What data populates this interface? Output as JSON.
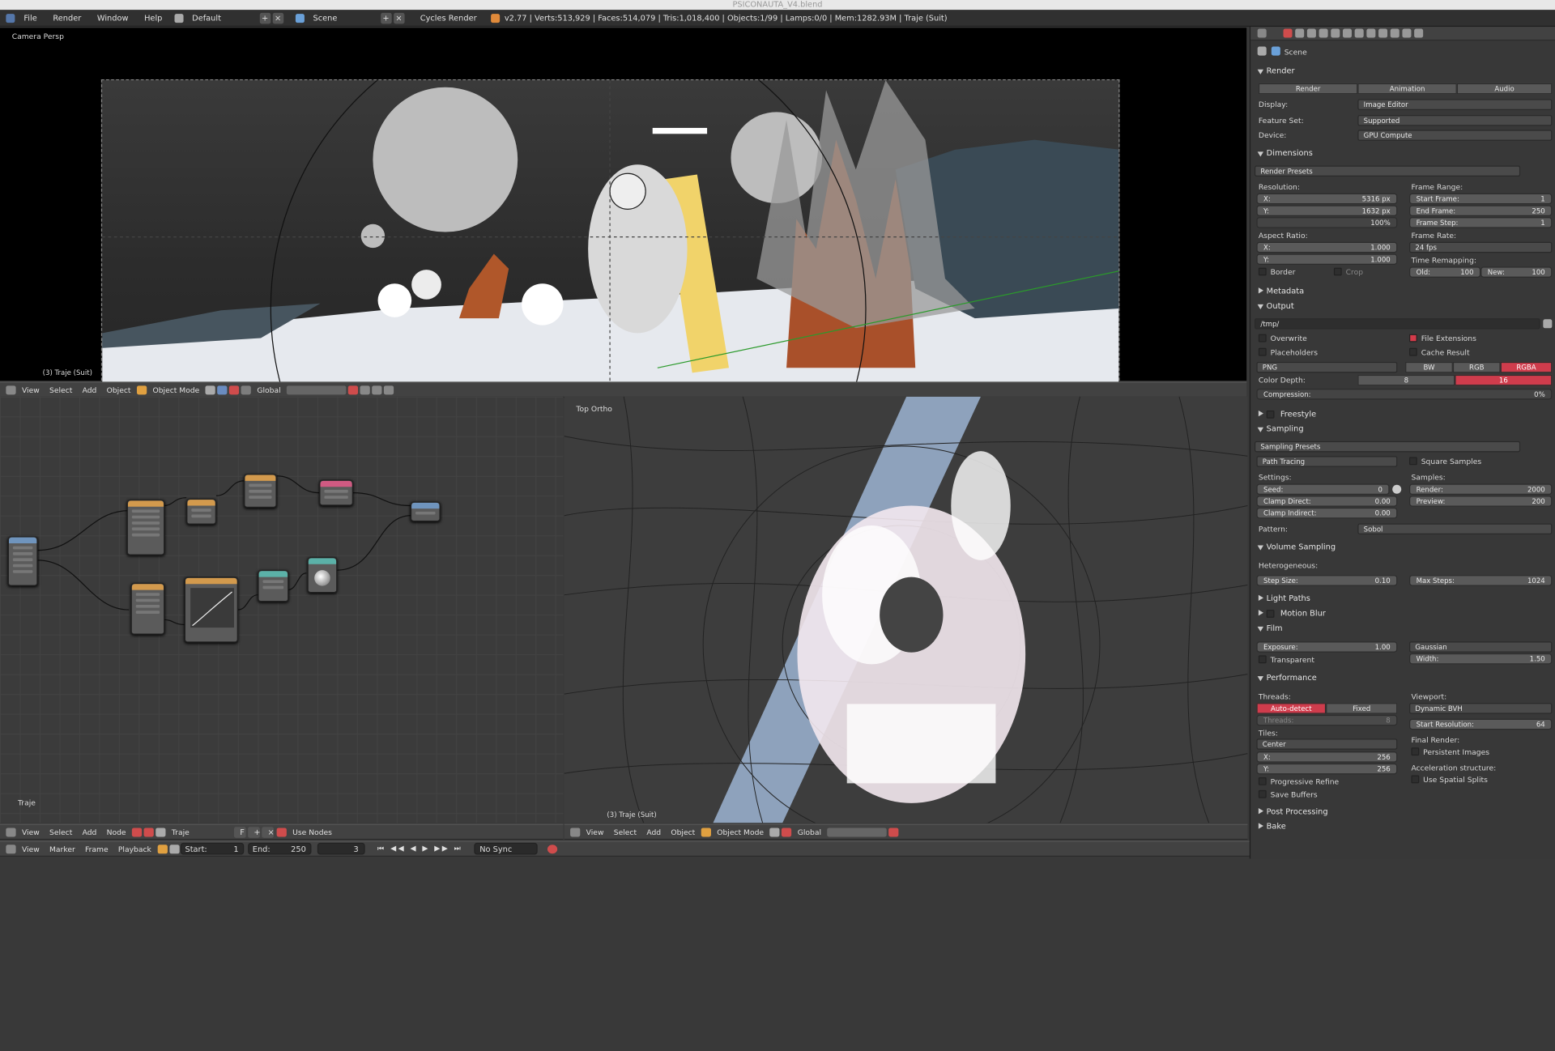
{
  "window": {
    "title": "PSICONAUTA_V4.blend"
  },
  "topbar": {
    "menus": [
      "File",
      "Render",
      "Window",
      "Help"
    ],
    "layout": "Default",
    "scene": "Scene",
    "engine": "Cycles Render",
    "stats": "v2.77 | Verts:513,929 | Faces:514,079 | Tris:1,018,400 | Objects:1/99 | Lamps:0/0 | Mem:1282.93M | Traje (Suit)"
  },
  "viewport_top": {
    "label": "Camera Persp",
    "object": "(3) Traje (Suit)"
  },
  "header_3d": {
    "menus": [
      "View",
      "Select",
      "Add",
      "Object"
    ],
    "mode": "Object Mode",
    "orientation": "Global"
  },
  "node_editor": {
    "label": "Traje",
    "menus": [
      "View",
      "Select",
      "Add",
      "Node"
    ],
    "material": "Traje",
    "use_nodes": "Use Nodes"
  },
  "viewport_bottom": {
    "label": "Top Ortho",
    "object": "(3) Traje (Suit)",
    "menus": [
      "View",
      "Select",
      "Add",
      "Object"
    ],
    "mode": "Object Mode",
    "orientation": "Global"
  },
  "timeline": {
    "menus": [
      "View",
      "Marker",
      "Frame",
      "Playback"
    ],
    "start_label": "Start:",
    "start": "1",
    "end_label": "End:",
    "end": "250",
    "current": "3",
    "sync": "No Sync"
  },
  "properties": {
    "breadcrumb": "Scene",
    "render": {
      "title": "Render",
      "buttons": [
        "Render",
        "Animation",
        "Audio"
      ],
      "display_label": "Display:",
      "display": "Image Editor",
      "feature_label": "Feature Set:",
      "feature": "Supported",
      "device_label": "Device:",
      "device": "GPU Compute"
    },
    "dimensions": {
      "title": "Dimensions",
      "presets": "Render Presets",
      "resolution_label": "Resolution:",
      "res_x_label": "X:",
      "res_x": "5316 px",
      "res_y_label": "Y:",
      "res_y": "1632 px",
      "res_pct": "100%",
      "aspect_label": "Aspect Ratio:",
      "asp_x_label": "X:",
      "asp_x": "1.000",
      "asp_y_label": "Y:",
      "asp_y": "1.000",
      "border": "Border",
      "crop": "Crop",
      "frame_range_label": "Frame Range:",
      "start_label": "Start Frame:",
      "start": "1",
      "end_label": "End Frame:",
      "end": "250",
      "step_label": "Frame Step:",
      "step": "1",
      "rate_label": "Frame Rate:",
      "rate": "24 fps",
      "remap_label": "Time Remapping:",
      "old_label": "Old:",
      "old": "100",
      "new_label": "New:",
      "new": "100"
    },
    "metadata": "Metadata",
    "output": {
      "title": "Output",
      "path": "/tmp/",
      "overwrite": "Overwrite",
      "file_ext": "File Extensions",
      "placeholders": "Placeholders",
      "cache": "Cache Result",
      "format": "PNG",
      "modes": [
        "BW",
        "RGB",
        "RGBA"
      ],
      "depth_label": "Color Depth:",
      "depths": [
        "8",
        "16"
      ],
      "compression_label": "Compression:",
      "compression": "0%"
    },
    "freestyle": "Freestyle",
    "sampling": {
      "title": "Sampling",
      "presets": "Sampling Presets",
      "method": "Path Tracing",
      "square": "Square Samples",
      "settings_label": "Settings:",
      "samples_label": "Samples:",
      "seed_label": "Seed:",
      "seed": "0",
      "clamp_direct_label": "Clamp Direct:",
      "clamp_direct": "0.00",
      "clamp_indirect_label": "Clamp Indirect:",
      "clamp_indirect": "0.00",
      "render_label": "Render:",
      "render": "2000",
      "preview_label": "Preview:",
      "preview": "200",
      "pattern_label": "Pattern:",
      "pattern": "Sobol"
    },
    "volume": {
      "title": "Volume Sampling",
      "hetero_label": "Heterogeneous:",
      "step_label": "Step Size:",
      "step": "0.10",
      "max_label": "Max Steps:",
      "max": "1024"
    },
    "light_paths": "Light Paths",
    "motion_blur": "Motion Blur",
    "film": {
      "title": "Film",
      "exposure_label": "Exposure:",
      "exposure": "1.00",
      "filter": "Gaussian",
      "width_label": "Width:",
      "width": "1.50",
      "transparent": "Transparent"
    },
    "performance": {
      "title": "Performance",
      "threads_label": "Threads:",
      "auto": "Auto-detect",
      "fixed": "Fixed",
      "threads_field_label": "Threads:",
      "threads_val": "8",
      "tiles_label": "Tiles:",
      "tiles_order": "Center",
      "tile_x_label": "X:",
      "tile_x": "256",
      "tile_y_label": "Y:",
      "tile_y": "256",
      "progressive": "Progressive Refine",
      "save_buffers": "Save Buffers",
      "viewport_label": "Viewport:",
      "viewport": "Dynamic BVH",
      "start_res_label": "Start Resolution:",
      "start_res": "64",
      "final_label": "Final Render:",
      "persistent": "Persistent Images",
      "accel_label": "Acceleration structure:",
      "spatial": "Use Spatial Splits"
    },
    "post_processing": "Post Processing",
    "bake": "Bake"
  }
}
